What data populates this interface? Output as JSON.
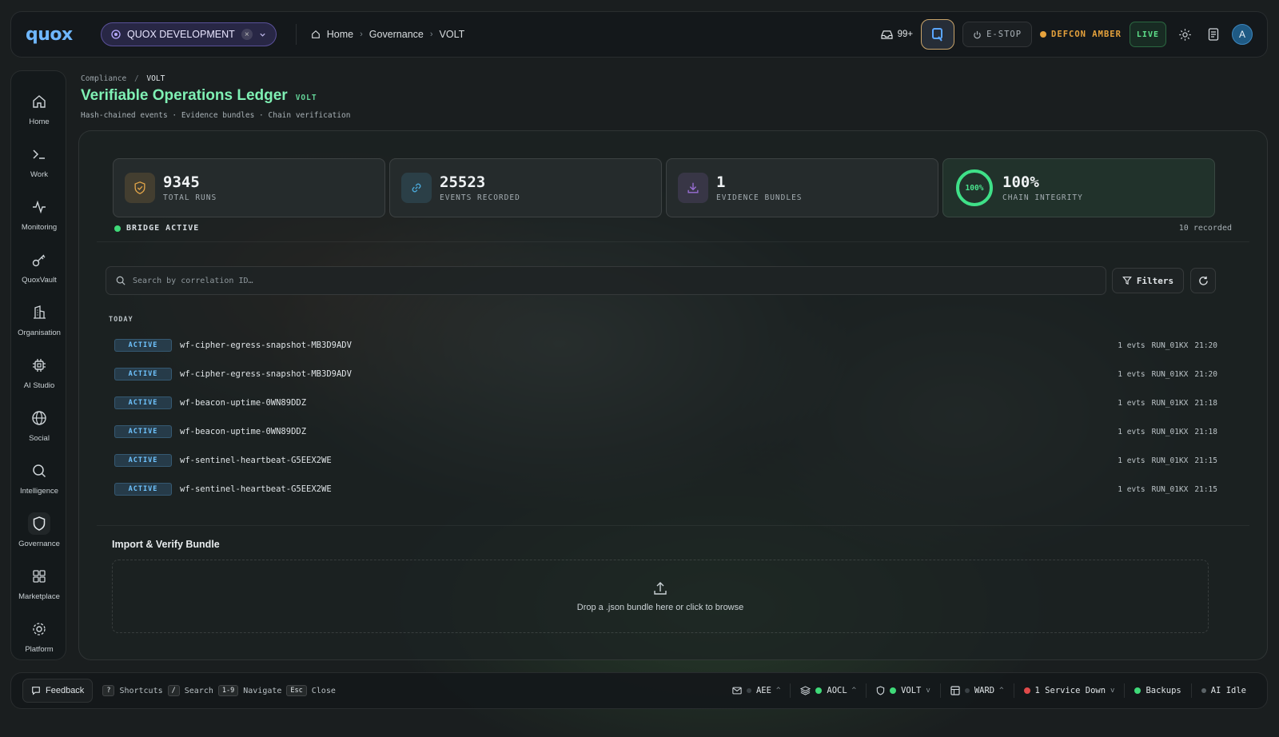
{
  "topbar": {
    "logo": "quox",
    "environment": "QUOX DEVELOPMENT",
    "breadcrumb": [
      "Home",
      "Governance",
      "VOLT"
    ],
    "inbox_count": "99+",
    "estop_label": "E-STOP",
    "defcon_label": "DEFCON AMBER",
    "live_label": "LIVE",
    "avatar_initial": "A"
  },
  "sidebar": {
    "items": [
      {
        "label": "Home",
        "icon": "home-icon"
      },
      {
        "label": "Work",
        "icon": "terminal-icon"
      },
      {
        "label": "Monitoring",
        "icon": "activity-icon"
      },
      {
        "label": "QuoxVault",
        "icon": "key-icon"
      },
      {
        "label": "Organisation",
        "icon": "building-icon"
      },
      {
        "label": "AI Studio",
        "icon": "cpu-icon"
      },
      {
        "label": "Social",
        "icon": "globe-icon"
      },
      {
        "label": "Intelligence",
        "icon": "search-icon"
      },
      {
        "label": "Governance",
        "icon": "shield-icon",
        "active": true
      },
      {
        "label": "Marketplace",
        "icon": "grid-icon"
      },
      {
        "label": "Platform",
        "icon": "gear-icon"
      }
    ]
  },
  "header": {
    "breadcrumb_parent": "Compliance",
    "breadcrumb_current": "VOLT",
    "title": "Verifiable Operations Ledger",
    "title_tag": "VOLT",
    "subtitle": "Hash-chained events · Evidence bundles · Chain verification"
  },
  "stats": [
    {
      "value": "9345",
      "caption": "TOTAL RUNS",
      "icon": "shield-icon",
      "color": "#e0a449"
    },
    {
      "value": "25523",
      "caption": "EVENTS RECORDED",
      "icon": "link-icon",
      "color": "#4aa8d8"
    },
    {
      "value": "1",
      "caption": "EVIDENCE BUNDLES",
      "icon": "download-icon",
      "color": "#9a6fd6"
    },
    {
      "value": "100%",
      "caption": "CHAIN INTEGRITY",
      "ring_label": "100%",
      "ring_fraction": 1.0,
      "color": "#3fe088"
    }
  ],
  "bridge": {
    "label": "BRIDGE ACTIVE",
    "recorded": "10 recorded"
  },
  "search": {
    "placeholder": "Search by correlation ID…"
  },
  "filters_label": "Filters",
  "group_label": "TODAY",
  "runs": [
    {
      "status": "ACTIVE",
      "name": "wf-cipher-egress-snapshot-MB3D9ADV",
      "evts": "1 evts",
      "run": "RUN_01KX",
      "time": "21:20"
    },
    {
      "status": "ACTIVE",
      "name": "wf-cipher-egress-snapshot-MB3D9ADV",
      "evts": "1 evts",
      "run": "RUN_01KX",
      "time": "21:20"
    },
    {
      "status": "ACTIVE",
      "name": "wf-beacon-uptime-0WN89DDZ",
      "evts": "1 evts",
      "run": "RUN_01KX",
      "time": "21:18"
    },
    {
      "status": "ACTIVE",
      "name": "wf-beacon-uptime-0WN89DDZ",
      "evts": "1 evts",
      "run": "RUN_01KX",
      "time": "21:18"
    },
    {
      "status": "ACTIVE",
      "name": "wf-sentinel-heartbeat-G5EEX2WE",
      "evts": "1 evts",
      "run": "RUN_01KX",
      "time": "21:15"
    },
    {
      "status": "ACTIVE",
      "name": "wf-sentinel-heartbeat-G5EEX2WE",
      "evts": "1 evts",
      "run": "RUN_01KX",
      "time": "21:15"
    }
  ],
  "import": {
    "title": "Import & Verify Bundle",
    "drop_text": "Drop a .json bundle here or click to browse"
  },
  "bottombar": {
    "feedback": "Feedback",
    "shortcuts": [
      {
        "key": "?",
        "label": "Shortcuts"
      },
      {
        "key": "/",
        "label": "Search"
      },
      {
        "key": "1-9",
        "label": "Navigate"
      },
      {
        "key": "Esc",
        "label": "Close"
      }
    ],
    "status": {
      "aee": "AEE",
      "aocl": "AOCL",
      "volt": "VOLT",
      "ward": "WARD",
      "service": "1 Service Down",
      "backups": "Backups",
      "ai": "AI Idle"
    }
  }
}
